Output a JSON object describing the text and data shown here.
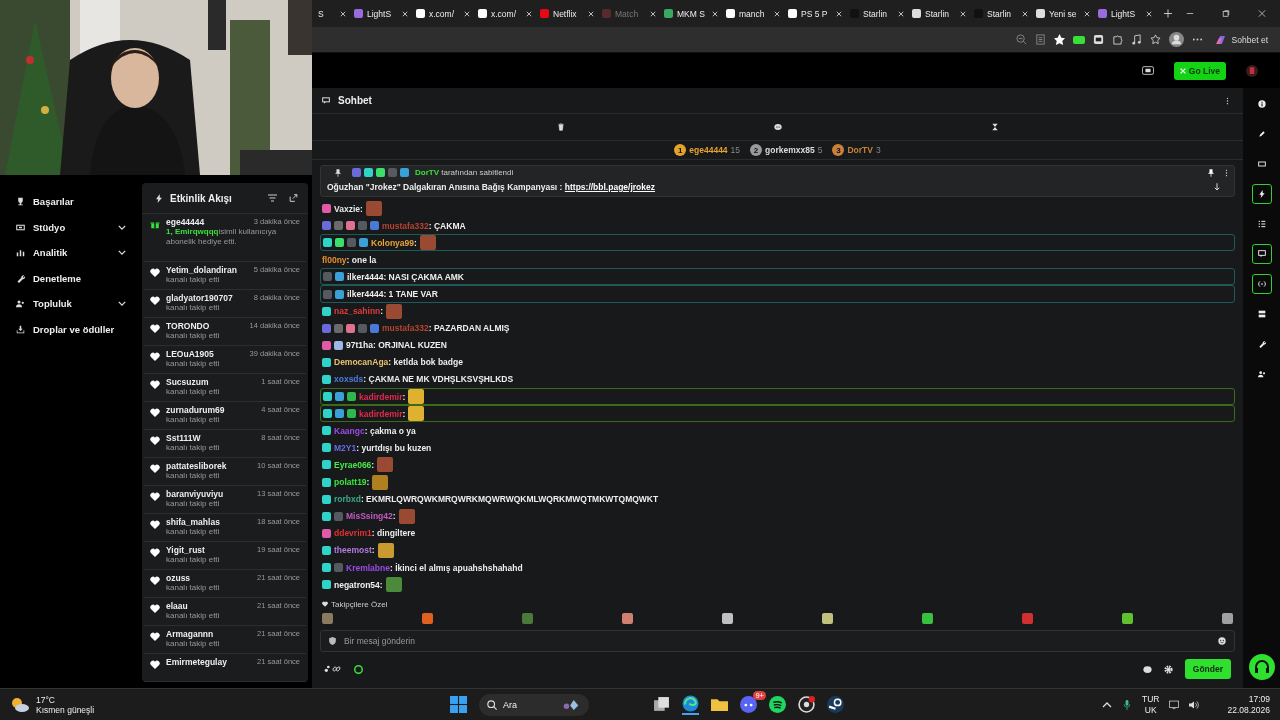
{
  "browser": {
    "tabs": [
      {
        "label": "S",
        "dimmed": false
      },
      {
        "label": "LightS",
        "dimmed": false
      },
      {
        "label": "x.com/",
        "dimmed": false
      },
      {
        "label": "x.com/",
        "dimmed": false
      },
      {
        "label": "Netflix",
        "dimmed": false
      },
      {
        "label": "Match",
        "dimmed": true
      },
      {
        "label": "MKM S",
        "dimmed": false
      },
      {
        "label": "manch",
        "dimmed": false
      },
      {
        "label": "PS 5 P",
        "dimmed": false
      },
      {
        "label": "Starlin",
        "dimmed": false
      },
      {
        "label": "Starlin",
        "dimmed": false
      },
      {
        "label": "Starlin",
        "dimmed": false
      },
      {
        "label": "Yeni se",
        "dimmed": false
      },
      {
        "label": "LightS",
        "dimmed": false
      }
    ],
    "chat_button": "Sohbet et"
  },
  "header": {
    "go_live": "Go Live"
  },
  "nav": {
    "items": [
      {
        "label": "Başarılar",
        "expandable": false
      },
      {
        "label": "Stüdyo",
        "expandable": true
      },
      {
        "label": "Analitik",
        "expandable": true
      },
      {
        "label": "Denetleme",
        "expandable": false
      },
      {
        "label": "Topluluk",
        "expandable": true
      },
      {
        "label": "Droplar ve ödüller",
        "expandable": false
      }
    ]
  },
  "activity_feed": {
    "title": "Etkinlik Akışı",
    "events": [
      {
        "kind": "gift",
        "user": "ege44444",
        "time": "3 dakika önce",
        "highlight": "1, Emirqwqqq",
        "detail": "isimli kullanıcıya abonelik hediye etti."
      },
      {
        "kind": "follow",
        "user": "Yetim_dolandiran",
        "time": "5 dakika önce",
        "detail": "kanalı takip etti"
      },
      {
        "kind": "follow",
        "user": "gladyator190707",
        "time": "8 dakika önce",
        "detail": "kanalı takip etti"
      },
      {
        "kind": "follow",
        "user": "TORONDO",
        "time": "14 dakika önce",
        "detail": "kanalı takip etti"
      },
      {
        "kind": "follow",
        "user": "LEOuA1905",
        "time": "39 dakika önce",
        "detail": "kanalı takip etti"
      },
      {
        "kind": "follow",
        "user": "Sucsuzum",
        "time": "1 saat önce",
        "detail": "kanalı takip etti"
      },
      {
        "kind": "follow",
        "user": "zurnadurum69",
        "time": "4 saat önce",
        "detail": "kanalı takip etti"
      },
      {
        "kind": "follow",
        "user": "Sst111W",
        "time": "8 saat önce",
        "detail": "kanalı takip etti"
      },
      {
        "kind": "follow",
        "user": "pattatesliborek",
        "time": "10 saat önce",
        "detail": "kanalı takip etti"
      },
      {
        "kind": "follow",
        "user": "baranviyuviyu",
        "time": "13 saat önce",
        "detail": "kanalı takip etti"
      },
      {
        "kind": "follow",
        "user": "shifa_mahlas",
        "time": "18 saat önce",
        "detail": "kanalı takip etti"
      },
      {
        "kind": "follow",
        "user": "Yigit_rust",
        "time": "19 saat önce",
        "detail": "kanalı takip etti"
      },
      {
        "kind": "follow",
        "user": "ozuss",
        "time": "21 saat önce",
        "detail": "kanalı takip etti"
      },
      {
        "kind": "follow",
        "user": "elaau",
        "time": "21 saat önce",
        "detail": "kanalı takip etti"
      },
      {
        "kind": "follow",
        "user": "Armagannn",
        "time": "21 saat önce",
        "detail": "kanalı takip etti"
      },
      {
        "kind": "follow",
        "user": "Emirmetegulay",
        "time": "21 saat önce"
      }
    ]
  },
  "chat": {
    "title": "Sohbet",
    "leaders": [
      {
        "rank": "1",
        "user": "ege44444",
        "count": "15",
        "color": "#e6a32a"
      },
      {
        "rank": "2",
        "user": "gorkemxx85",
        "count": "5",
        "color": "#9a9a9a"
      },
      {
        "rank": "3",
        "user": "DorTV",
        "count": "3",
        "color": "#c7813a"
      }
    ],
    "pinned": {
      "by": "DorTV",
      "by_suffix": "tarafından sabitlendi",
      "text": "Oğuzhan \"Jrokez\" Dalgakıran Anısına Bağış Kampanyası : ",
      "link": "https://bbl.page/jrokez"
    },
    "messages": [
      {
        "user": "Vaxzie",
        "color": "#e8e8e8",
        "text": ":",
        "kind": "normal"
      },
      {
        "user": "mustafa332",
        "color": "#b8432f",
        "text": ": ÇAKMA",
        "kind": "normal"
      },
      {
        "user": "Kolonya99",
        "color": "#e8a33d",
        "text": ":",
        "kind": "teal"
      },
      {
        "user": "fl00ny",
        "color": "#e8902e",
        "text": ": one la",
        "kind": "normal"
      },
      {
        "user": "ilker4444",
        "color": "#f0f0f0",
        "text": ": NASI ÇAKMA AMK",
        "kind": "teal"
      },
      {
        "user": "ilker4444",
        "color": "#f0f0f0",
        "text": ": 1 TANE VAR",
        "kind": "teal"
      },
      {
        "user": "naz_sahinn",
        "color": "#e03a3a",
        "text": ":",
        "kind": "normal"
      },
      {
        "user": "mustafa332",
        "color": "#b8432f",
        "text": ": PAZARDAN ALMIŞ",
        "kind": "normal"
      },
      {
        "user": "97t1ha",
        "color": "#f0f0f0",
        "text": ": ORJINAL KUZEN",
        "kind": "normal"
      },
      {
        "user": "DemocanAga",
        "color": "#e8c070",
        "text": ": ketlda bok badge",
        "kind": "normal"
      },
      {
        "user": "xoxsds",
        "color": "#4a7ae0",
        "text": ": ÇAKMA NE MK VDHŞLKSVŞHLKDS",
        "kind": "normal"
      },
      {
        "user": "kadirdemir",
        "color": "#e02a4a",
        "text": ":",
        "kind": "green"
      },
      {
        "user": "kadirdemir",
        "color": "#e02a4a",
        "text": ":",
        "kind": "green"
      },
      {
        "user": "Kaangc",
        "color": "#9a4ae8",
        "text": ": çakma o ya",
        "kind": "normal"
      },
      {
        "user": "M2Y1",
        "color": "#6a6ae8",
        "text": ": yurtdışı bu kuzen",
        "kind": "normal"
      },
      {
        "user": "Eyrae066",
        "color": "#4ae84a",
        "text": ":",
        "kind": "normal"
      },
      {
        "user": "polatt19",
        "color": "#3ae83a",
        "text": ":",
        "kind": "normal"
      },
      {
        "user": "rorbxd",
        "color": "#3aa88a",
        "text": ": EKMRLQWRQWKMRQWRKMQWRWQKMLWQRKMWQTMKWTQMQWKT",
        "kind": "normal"
      },
      {
        "user": "MisSsing42",
        "color": "#c05ac0",
        "text": ":",
        "kind": "normal"
      },
      {
        "user": "ddevrim1",
        "color": "#e03030",
        "text": ": dingiltere",
        "kind": "normal"
      },
      {
        "user": "theemost",
        "color": "#b07ae0",
        "text": ":",
        "kind": "normal"
      },
      {
        "user": "Kremlabne",
        "color": "#9a4ae8",
        "text": ": İkinci el almış apuahshshahahd",
        "kind": "normal"
      },
      {
        "user": "negatron54",
        "color": "#f0f0f0",
        "text": ":",
        "kind": "normal"
      }
    ],
    "followers_only": "Takipçilere Özel",
    "input": {
      "placeholder": "Bir mesaj gönderin"
    },
    "send": "Gönder"
  },
  "rail": [
    {
      "kind": "info",
      "selected": false
    },
    {
      "kind": "pen",
      "selected": false
    },
    {
      "kind": "studio",
      "selected": false
    },
    {
      "kind": "bolt",
      "selected": true
    },
    {
      "kind": "list",
      "selected": false
    },
    {
      "kind": "chat",
      "selected": true
    },
    {
      "kind": "signal",
      "selected": true
    },
    {
      "kind": "stack",
      "selected": false
    },
    {
      "kind": "wrench",
      "selected": false
    },
    {
      "kind": "people",
      "selected": false
    }
  ],
  "taskbar": {
    "temperature": "17°C",
    "weather": "Kısmen güneşli",
    "search": "Ara",
    "discord_badge": "9+",
    "language": "TUR",
    "layout": "UK",
    "time": "17:09",
    "date": "22.08.2026"
  }
}
